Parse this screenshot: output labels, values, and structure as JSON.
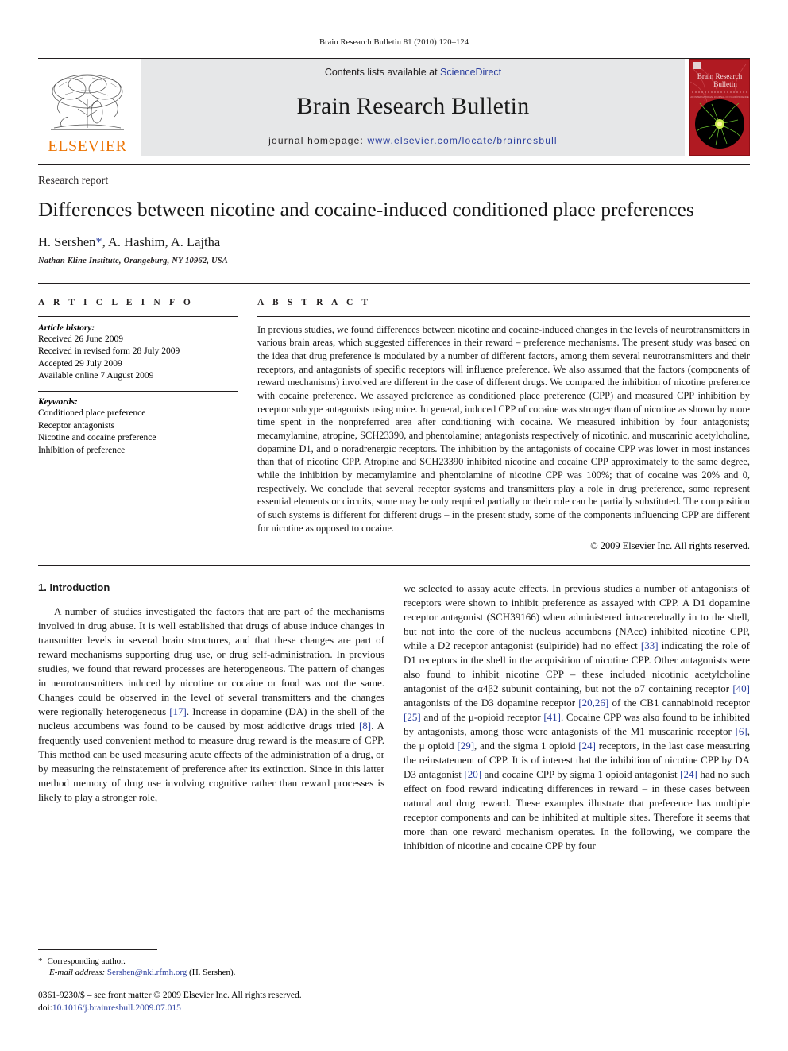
{
  "running_head": "Brain Research Bulletin 81 (2010) 120–124",
  "masthead": {
    "publisher_logo_text": "ELSEVIER",
    "contents_prefix": "Contents lists available at ",
    "contents_link": "ScienceDirect",
    "journal_title": "Brain Research Bulletin",
    "homepage_prefix": "journal homepage: ",
    "homepage_url": "www.elsevier.com/locate/brainresbull",
    "cover_title_line1": "Brain Research",
    "cover_title_line2": "Bulletin",
    "brand_orange": "#ec7404",
    "link_blue": "#2b3f9e",
    "cover_red": "#b01a22",
    "band_gray": "#e6e7e8"
  },
  "title_block": {
    "article_type": "Research report",
    "title": "Differences between nicotine and cocaine-induced conditioned place preferences",
    "authors": "H. Sershen",
    "corresponding_marker": "*",
    "authors_rest": ", A. Hashim, A. Lajtha",
    "affiliation": "Nathan Kline Institute, Orangeburg, NY 10962, USA"
  },
  "article_info": {
    "label": "A R T I C L E   I N F O",
    "history_head": "Article history:",
    "history": [
      "Received 26 June 2009",
      "Received in revised form 28 July 2009",
      "Accepted 29 July 2009",
      "Available online 7 August 2009"
    ],
    "keywords_head": "Keywords:",
    "keywords": [
      "Conditioned place preference",
      "Receptor antagonists",
      "Nicotine and cocaine preference",
      "Inhibition of preference"
    ]
  },
  "abstract": {
    "label": "A B S T R A C T",
    "text": "In previous studies, we found differences between nicotine and cocaine-induced changes in the levels of neurotransmitters in various brain areas, which suggested differences in their reward – preference mechanisms. The present study was based on the idea that drug preference is modulated by a number of different factors, among them several neurotransmitters and their receptors, and antagonists of specific receptors will influence preference. We also assumed that the factors (components of reward mechanisms) involved are different in the case of different drugs. We compared the inhibition of nicotine preference with cocaine preference. We assayed preference as conditioned place preference (CPP) and measured CPP inhibition by receptor subtype antagonists using mice. In general, induced CPP of cocaine was stronger than of nicotine as shown by more time spent in the nonpreferred area after conditioning with cocaine. We measured inhibition by four antagonists; mecamylamine, atropine, SCH23390, and phentolamine; antagonists respectively of nicotinic, and muscarinic acetylcholine, dopamine D1, and α noradrenergic receptors. The inhibition by the antagonists of cocaine CPP was lower in most instances than that of nicotine CPP. Atropine and SCH23390 inhibited nicotine and cocaine CPP approximately to the same degree, while the inhibition by mecamylamine and phentolamine of nicotine CPP was 100%; that of cocaine was 20% and 0, respectively. We conclude that several receptor systems and transmitters play a role in drug preference, some represent essential elements or circuits, some may be only required partially or their role can be partially substituted. The composition of such systems is different for different drugs – in the present study, some of the components influencing CPP are different for nicotine as opposed to cocaine.",
    "copyright": "© 2009 Elsevier Inc. All rights reserved."
  },
  "introduction": {
    "heading": "1. Introduction",
    "left_paragraph_part1": "A number of studies investigated the factors that are part of the mechanisms involved in drug abuse. It is well established that drugs of abuse induce changes in transmitter levels in several brain structures, and that these changes are part of reward mechanisms supporting drug use, or drug self-administration. In previous studies, we found that reward processes are heterogeneous. The pattern of changes in neurotransmitters induced by nicotine or cocaine or food was not the same. Changes could be observed in the level of several transmitters and the changes were regionally heterogeneous ",
    "ref_17": "[17]",
    "left_paragraph_part2": ". Increase in dopamine (DA) in the shell of the nucleus accumbens was found to be caused by most addictive drugs tried ",
    "ref_8": "[8]",
    "left_paragraph_part3": ". A frequently used convenient method to measure drug reward is the measure of CPP. This method can be used measuring acute effects of the administration of a drug, or by measuring the reinstatement of preference after its extinction. Since in this latter method memory of drug use involving cognitive rather than reward processes is likely to play a stronger role,",
    "right_part1": "we selected to assay acute effects. In previous studies a number of antagonists of receptors were shown to inhibit preference as assayed with CPP. A D1 dopamine receptor antagonist (SCH39166) when administered intracerebrally in to the shell, but not into the core of the nucleus accumbens (NAcc) inhibited nicotine CPP, while a D2 receptor antagonist (sulpiride) had no effect ",
    "ref_33": "[33]",
    "right_part2": " indicating the role of D1 receptors in the shell in the acquisition of nicotine CPP. Other antagonists were also found to inhibit nicotine CPP – these included nicotinic acetylcholine antagonist of the α4β2 subunit containing, but not the α7 containing receptor ",
    "ref_40": "[40]",
    "right_part3": " antagonists of the D3 dopamine receptor ",
    "ref_2026": "[20,26]",
    "right_part4": " of the CB1 cannabinoid receptor ",
    "ref_25": "[25]",
    "right_part5": " and of the μ-opioid receptor ",
    "ref_41": "[41]",
    "right_part6": ". Cocaine CPP was also found to be inhibited by antagonists, among those were antagonists of the M1 muscarinic receptor ",
    "ref_6": "[6]",
    "right_part7": ", the μ opioid ",
    "ref_29": "[29]",
    "right_part8": ", and the sigma 1 opioid ",
    "ref_24": "[24]",
    "right_part9": " receptors, in the last case measuring the reinstatement of CPP. It is of interest that the inhibition of nicotine CPP by DA D3 antagonist ",
    "ref_20": "[20]",
    "right_part10": " and cocaine CPP by sigma 1 opioid antagonist ",
    "ref_24b": "[24]",
    "right_part11": " had no such effect on food reward indicating differences in reward – in these cases between natural and drug reward. These examples illustrate that preference has multiple receptor components and can be inhibited at multiple sites. Therefore it seems that more than one reward mechanism operates. In the following, we compare the inhibition of nicotine and cocaine CPP by four"
  },
  "footnote": {
    "star": "*",
    "corresponding": "Corresponding author.",
    "email_label": "E-mail address:",
    "email": "Sershen@nki.rfmh.org",
    "email_suffix": "(H. Sershen)."
  },
  "imprint": {
    "line1": "0361-9230/$ – see front matter © 2009 Elsevier Inc. All rights reserved.",
    "doi_label": "doi:",
    "doi": "10.1016/j.brainresbull.2009.07.015"
  }
}
